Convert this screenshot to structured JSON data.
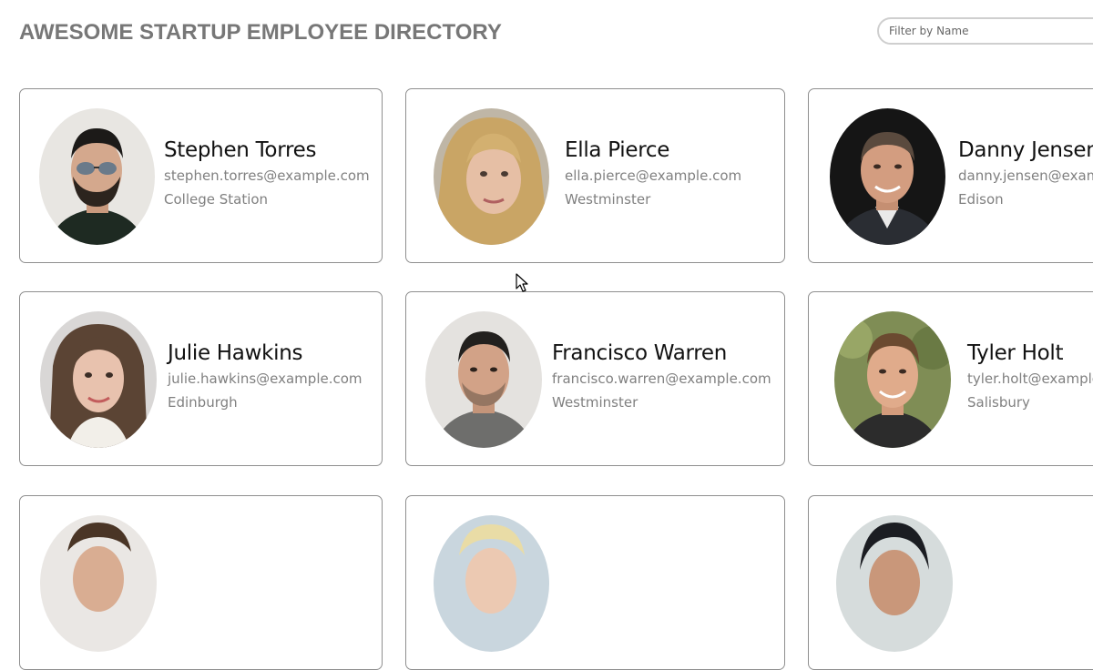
{
  "header": {
    "title": "AWESOME STARTUP EMPLOYEE DIRECTORY",
    "search_placeholder": "Filter by Name"
  },
  "employees": [
    {
      "name": "Stephen Torres",
      "email": "stephen.torres@example.com",
      "city": "College Station"
    },
    {
      "name": "Ella Pierce",
      "email": "ella.pierce@example.com",
      "city": "Westminster"
    },
    {
      "name": "Danny Jensen",
      "email": "danny.jensen@example.com",
      "city": "Edison"
    },
    {
      "name": "Julie Hawkins",
      "email": "julie.hawkins@example.com",
      "city": "Edinburgh"
    },
    {
      "name": "Francisco Warren",
      "email": "francisco.warren@example.com",
      "city": "Westminster"
    },
    {
      "name": "Tyler Holt",
      "email": "tyler.holt@example.com",
      "city": "Salisbury"
    }
  ],
  "colors": {
    "title": "#777777",
    "card_border": "#8f8f8f",
    "secondary_text": "#808080"
  }
}
